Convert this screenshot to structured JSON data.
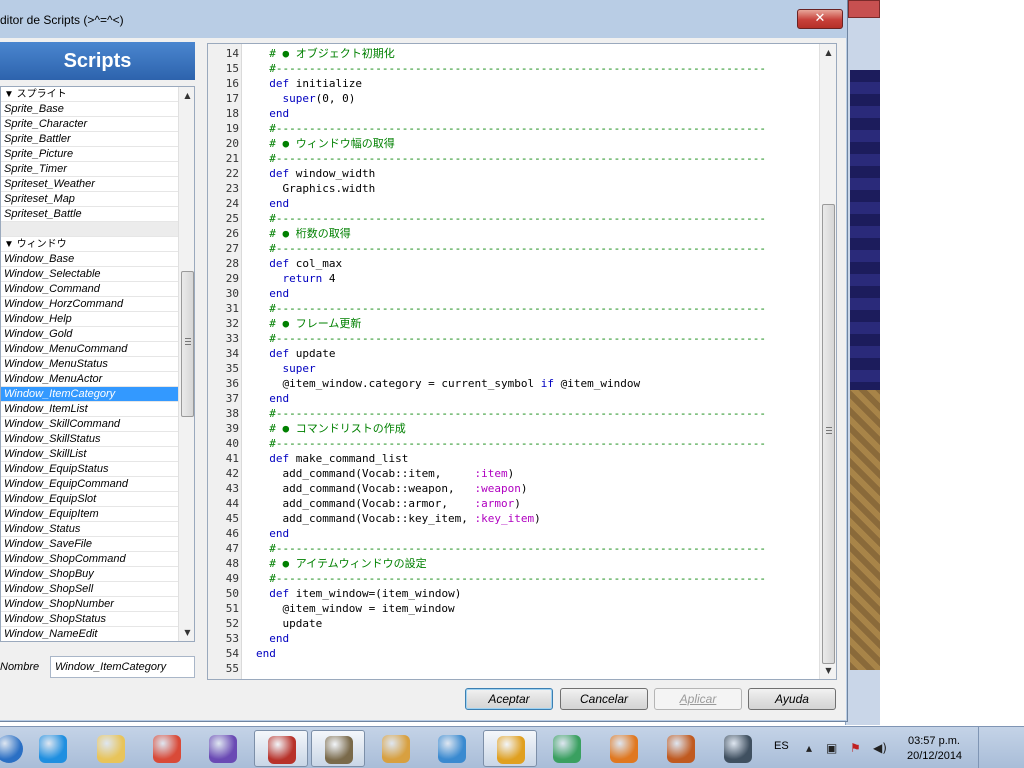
{
  "window": {
    "title": "ditor de Scripts (>^=^<)",
    "close_glyph": "✕"
  },
  "sidebar": {
    "header": "Scripts",
    "items": [
      {
        "label": "▼ スプライト",
        "kind": "group"
      },
      {
        "label": "Sprite_Base",
        "kind": "item"
      },
      {
        "label": "Sprite_Character",
        "kind": "item"
      },
      {
        "label": "Sprite_Battler",
        "kind": "item"
      },
      {
        "label": "Sprite_Picture",
        "kind": "item"
      },
      {
        "label": "Sprite_Timer",
        "kind": "item"
      },
      {
        "label": "Spriteset_Weather",
        "kind": "item"
      },
      {
        "label": "Spriteset_Map",
        "kind": "item"
      },
      {
        "label": "Spriteset_Battle",
        "kind": "item"
      },
      {
        "label": "",
        "kind": "blank"
      },
      {
        "label": "▼ ウィンドウ",
        "kind": "group"
      },
      {
        "label": "Window_Base",
        "kind": "item"
      },
      {
        "label": "Window_Selectable",
        "kind": "item"
      },
      {
        "label": "Window_Command",
        "kind": "item"
      },
      {
        "label": "Window_HorzCommand",
        "kind": "item"
      },
      {
        "label": "Window_Help",
        "kind": "item"
      },
      {
        "label": "Window_Gold",
        "kind": "item"
      },
      {
        "label": "Window_MenuCommand",
        "kind": "item"
      },
      {
        "label": "Window_MenuStatus",
        "kind": "item"
      },
      {
        "label": "Window_MenuActor",
        "kind": "item"
      },
      {
        "label": "Window_ItemCategory",
        "kind": "selected"
      },
      {
        "label": "Window_ItemList",
        "kind": "item"
      },
      {
        "label": "Window_SkillCommand",
        "kind": "item"
      },
      {
        "label": "Window_SkillStatus",
        "kind": "item"
      },
      {
        "label": "Window_SkillList",
        "kind": "item"
      },
      {
        "label": "Window_EquipStatus",
        "kind": "item"
      },
      {
        "label": "Window_EquipCommand",
        "kind": "item"
      },
      {
        "label": "Window_EquipSlot",
        "kind": "item"
      },
      {
        "label": "Window_EquipItem",
        "kind": "item"
      },
      {
        "label": "Window_Status",
        "kind": "item"
      },
      {
        "label": "Window_SaveFile",
        "kind": "item"
      },
      {
        "label": "Window_ShopCommand",
        "kind": "item"
      },
      {
        "label": "Window_ShopBuy",
        "kind": "item"
      },
      {
        "label": "Window_ShopSell",
        "kind": "item"
      },
      {
        "label": "Window_ShopNumber",
        "kind": "item"
      },
      {
        "label": "Window_ShopStatus",
        "kind": "item"
      },
      {
        "label": "Window_NameEdit",
        "kind": "item"
      }
    ],
    "name_label": "Nombre",
    "name_value": "Window_ItemCategory"
  },
  "editor": {
    "lines": [
      {
        "n": "14",
        "segs": [
          [
            "c",
            "  # ● オブジェクト初期化"
          ]
        ]
      },
      {
        "n": "15",
        "segs": [
          [
            "c",
            "  #--------------------------------------------------------------------------"
          ]
        ]
      },
      {
        "n": "16",
        "segs": [
          [
            "k",
            "  def "
          ],
          [
            "t",
            "initialize"
          ]
        ]
      },
      {
        "n": "17",
        "segs": [
          [
            "k",
            "    super"
          ],
          [
            "t",
            "(0, 0)"
          ]
        ]
      },
      {
        "n": "18",
        "segs": [
          [
            "k",
            "  end"
          ]
        ]
      },
      {
        "n": "19",
        "segs": [
          [
            "c",
            "  #--------------------------------------------------------------------------"
          ]
        ]
      },
      {
        "n": "20",
        "segs": [
          [
            "c",
            "  # ● ウィンドウ幅の取得"
          ]
        ]
      },
      {
        "n": "21",
        "segs": [
          [
            "c",
            "  #--------------------------------------------------------------------------"
          ]
        ]
      },
      {
        "n": "22",
        "segs": [
          [
            "k",
            "  def "
          ],
          [
            "t",
            "window_width"
          ]
        ]
      },
      {
        "n": "23",
        "segs": [
          [
            "t",
            "    Graphics.width"
          ]
        ]
      },
      {
        "n": "24",
        "segs": [
          [
            "k",
            "  end"
          ]
        ]
      },
      {
        "n": "25",
        "segs": [
          [
            "c",
            "  #--------------------------------------------------------------------------"
          ]
        ]
      },
      {
        "n": "26",
        "segs": [
          [
            "c",
            "  # ● 桁数の取得"
          ]
        ]
      },
      {
        "n": "27",
        "segs": [
          [
            "c",
            "  #--------------------------------------------------------------------------"
          ]
        ]
      },
      {
        "n": "28",
        "segs": [
          [
            "k",
            "  def "
          ],
          [
            "t",
            "col_max"
          ]
        ]
      },
      {
        "n": "29",
        "segs": [
          [
            "k",
            "    return "
          ],
          [
            "t",
            "4"
          ]
        ]
      },
      {
        "n": "30",
        "segs": [
          [
            "k",
            "  end"
          ]
        ]
      },
      {
        "n": "31",
        "segs": [
          [
            "c",
            "  #--------------------------------------------------------------------------"
          ]
        ]
      },
      {
        "n": "32",
        "segs": [
          [
            "c",
            "  # ● フレーム更新"
          ]
        ]
      },
      {
        "n": "33",
        "segs": [
          [
            "c",
            "  #--------------------------------------------------------------------------"
          ]
        ]
      },
      {
        "n": "34",
        "segs": [
          [
            "k",
            "  def "
          ],
          [
            "t",
            "update"
          ]
        ]
      },
      {
        "n": "35",
        "segs": [
          [
            "k",
            "    super"
          ]
        ]
      },
      {
        "n": "36",
        "segs": [
          [
            "t",
            "    @item_window.category = current_symbol "
          ],
          [
            "k",
            "if "
          ],
          [
            "t",
            "@item_window"
          ]
        ]
      },
      {
        "n": "37",
        "segs": [
          [
            "k",
            "  end"
          ]
        ]
      },
      {
        "n": "38",
        "segs": [
          [
            "c",
            "  #--------------------------------------------------------------------------"
          ]
        ]
      },
      {
        "n": "39",
        "segs": [
          [
            "c",
            "  # ● コマンドリストの作成"
          ]
        ]
      },
      {
        "n": "40",
        "segs": [
          [
            "c",
            "  #--------------------------------------------------------------------------"
          ]
        ]
      },
      {
        "n": "41",
        "segs": [
          [
            "k",
            "  def "
          ],
          [
            "t",
            "make_command_list"
          ]
        ]
      },
      {
        "n": "42",
        "segs": [
          [
            "t",
            "    add_command(Vocab::item,     "
          ],
          [
            "s",
            ":item"
          ],
          [
            "t",
            ")"
          ]
        ]
      },
      {
        "n": "43",
        "segs": [
          [
            "t",
            "    add_command(Vocab::weapon,   "
          ],
          [
            "s",
            ":weapon"
          ],
          [
            "t",
            ")"
          ]
        ]
      },
      {
        "n": "44",
        "segs": [
          [
            "t",
            "    add_command(Vocab::armor,    "
          ],
          [
            "s",
            ":armor"
          ],
          [
            "t",
            ")"
          ]
        ]
      },
      {
        "n": "45",
        "segs": [
          [
            "t",
            "    add_command(Vocab::key_item, "
          ],
          [
            "s",
            ":key_item"
          ],
          [
            "t",
            ")"
          ]
        ]
      },
      {
        "n": "46",
        "segs": [
          [
            "k",
            "  end"
          ]
        ]
      },
      {
        "n": "47",
        "segs": [
          [
            "c",
            "  #--------------------------------------------------------------------------"
          ]
        ]
      },
      {
        "n": "48",
        "segs": [
          [
            "c",
            "  # ● アイテムウィンドウの設定"
          ]
        ]
      },
      {
        "n": "49",
        "segs": [
          [
            "c",
            "  #--------------------------------------------------------------------------"
          ]
        ]
      },
      {
        "n": "50",
        "segs": [
          [
            "k",
            "  def "
          ],
          [
            "t",
            "item_window=(item_window)"
          ]
        ]
      },
      {
        "n": "51",
        "segs": [
          [
            "t",
            "    @item_window = item_window"
          ]
        ]
      },
      {
        "n": "52",
        "segs": [
          [
            "t",
            "    update"
          ]
        ]
      },
      {
        "n": "53",
        "segs": [
          [
            "k",
            "  end"
          ]
        ]
      },
      {
        "n": "54",
        "segs": [
          [
            "k",
            "end"
          ]
        ]
      },
      {
        "n": "55",
        "segs": []
      }
    ]
  },
  "buttons": {
    "accept": "Aceptar",
    "cancel": "Cancelar",
    "apply": "Aplicar",
    "help": "Ayuda"
  },
  "taskbar": {
    "apps": [
      {
        "name": "start-orb-icon",
        "color": "#2a6fc4",
        "active": false
      },
      {
        "name": "internet-explorer-icon",
        "color": "#1f8fe0",
        "active": false
      },
      {
        "name": "file-explorer-icon",
        "color": "#e8c45a",
        "active": false
      },
      {
        "name": "chrome-icon",
        "color": "#d94a38",
        "active": false
      },
      {
        "name": "game-controller-icon",
        "color": "#6a4ab4",
        "active": false
      },
      {
        "name": "rpg-maker-icon",
        "color": "#b8322a",
        "active": true
      },
      {
        "name": "gimp-icon",
        "color": "#7a6a4a",
        "active": true
      },
      {
        "name": "paint-palette-icon",
        "color": "#d8a040",
        "active": false
      },
      {
        "name": "ccleaner-icon",
        "color": "#3a8ad0",
        "active": false
      },
      {
        "name": "winamp-icon",
        "color": "#e0a020",
        "active": true
      },
      {
        "name": "3d-cube-icon",
        "color": "#3aa060",
        "active": false
      },
      {
        "name": "audacity-icon",
        "color": "#e07820",
        "active": false
      },
      {
        "name": "baseball-glove-icon",
        "color": "#c05a20",
        "active": false
      },
      {
        "name": "terminal-icon",
        "color": "#405060",
        "active": false
      }
    ],
    "lang": "ES",
    "time": "03:57 p.m.",
    "date": "20/12/2014"
  }
}
